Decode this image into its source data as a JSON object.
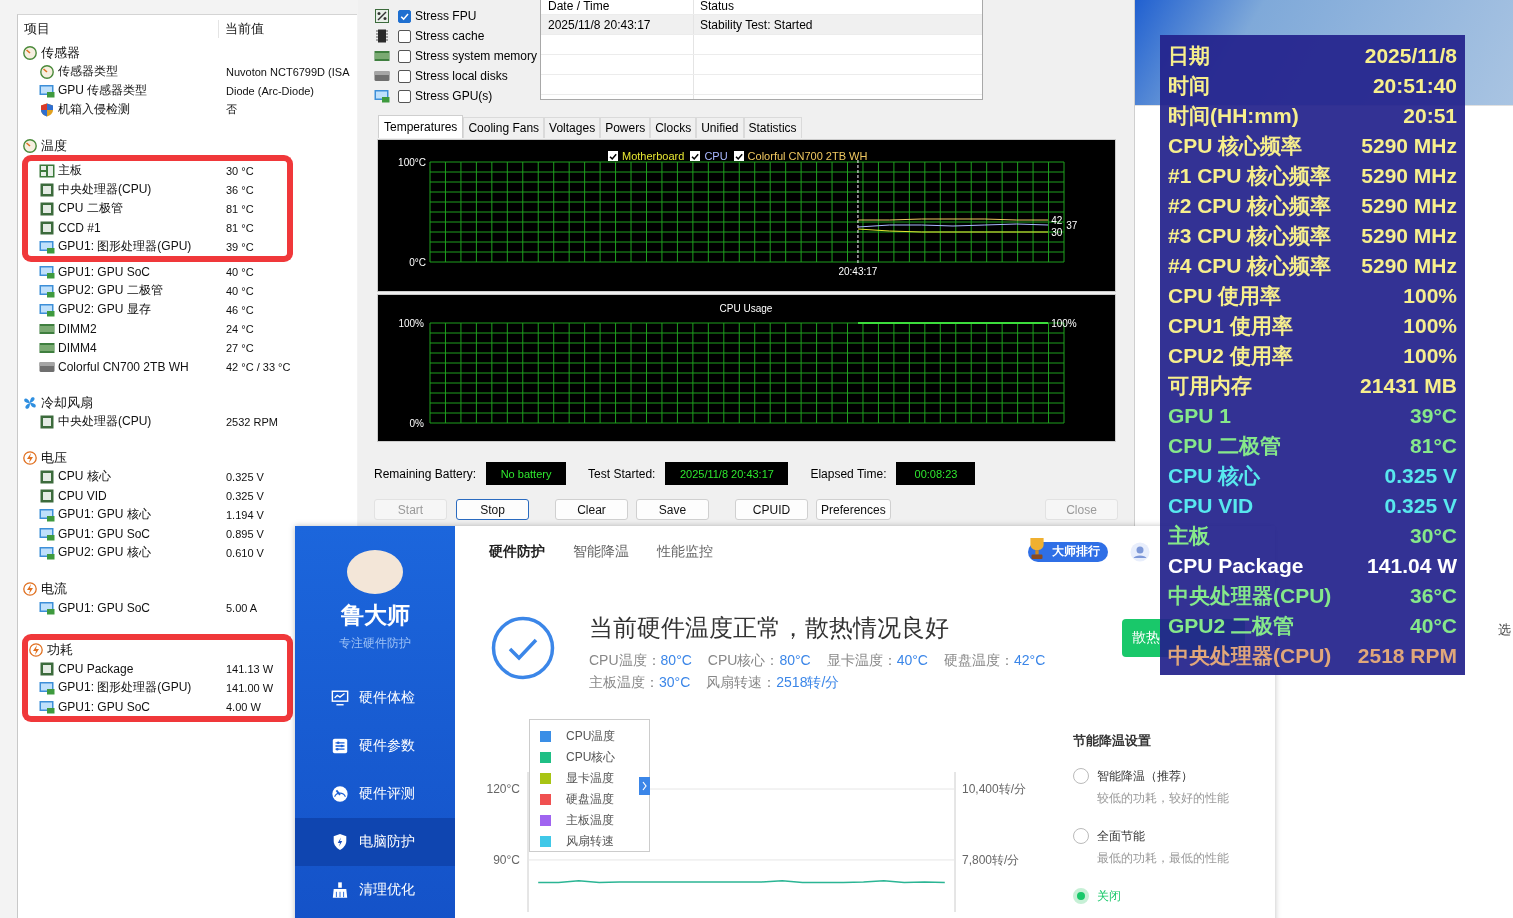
{
  "sensor_window": {
    "columns": [
      "项目",
      "当前值"
    ],
    "groups": [
      {
        "title": "传感器",
        "kind": "gauge",
        "highlight": false,
        "items": [
          {
            "name": "传感器类型",
            "value": "Nuvoton NCT6799D  (ISA",
            "kind": "gauge",
            "highlight": false
          },
          {
            "name": "GPU 传感器类型",
            "value": "Diode  (Arc-Diode)",
            "kind": "gpu",
            "highlight": false
          },
          {
            "name": "机箱入侵检测",
            "value": "否",
            "kind": "shield",
            "highlight": false
          }
        ]
      },
      {
        "title": "温度",
        "kind": "gauge",
        "highlight": false,
        "items": [
          {
            "name": "主板",
            "value": "30 °C",
            "kind": "board",
            "highlight": true
          },
          {
            "name": "中央处理器(CPU)",
            "value": "36 °C",
            "kind": "chip",
            "highlight": true
          },
          {
            "name": "CPU 二极管",
            "value": "81 °C",
            "kind": "chip",
            "highlight": true
          },
          {
            "name": "CCD #1",
            "value": "81 °C",
            "kind": "chip",
            "highlight": true
          },
          {
            "name": "GPU1: 图形处理器(GPU)",
            "value": "39 °C",
            "kind": "gpu",
            "highlight": true
          },
          {
            "name": "GPU1: GPU SoC",
            "value": "40 °C",
            "kind": "gpu",
            "highlight": false
          },
          {
            "name": "GPU2: GPU 二极管",
            "value": "40 °C",
            "kind": "gpu",
            "highlight": false
          },
          {
            "name": "GPU2: GPU 显存",
            "value": "46 °C",
            "kind": "gpu",
            "highlight": false
          },
          {
            "name": "DIMM2",
            "value": "24 °C",
            "kind": "ram",
            "highlight": false
          },
          {
            "name": "DIMM4",
            "value": "27 °C",
            "kind": "ram",
            "highlight": false
          },
          {
            "name": "Colorful CN700 2TB WH",
            "value": "42 °C / 33 °C",
            "kind": "disk",
            "highlight": false
          }
        ]
      },
      {
        "title": "冷却风扇",
        "kind": "fan",
        "highlight": false,
        "items": [
          {
            "name": "中央处理器(CPU)",
            "value": "2532 RPM",
            "kind": "chip",
            "highlight": false
          }
        ]
      },
      {
        "title": "电压",
        "kind": "bolt",
        "highlight": false,
        "items": [
          {
            "name": "CPU 核心",
            "value": "0.325 V",
            "kind": "chip",
            "highlight": false
          },
          {
            "name": "CPU VID",
            "value": "0.325 V",
            "kind": "chip",
            "highlight": false
          },
          {
            "name": "GPU1: GPU 核心",
            "value": "1.194 V",
            "kind": "gpu",
            "highlight": false
          },
          {
            "name": "GPU1: GPU SoC",
            "value": "0.895 V",
            "kind": "gpu",
            "highlight": false
          },
          {
            "name": "GPU2: GPU 核心",
            "value": "0.610 V",
            "kind": "gpu",
            "highlight": false
          }
        ]
      },
      {
        "title": "电流",
        "kind": "bolt",
        "highlight": false,
        "items": [
          {
            "name": "GPU1: GPU SoC",
            "value": "5.00 A",
            "kind": "gpu",
            "highlight": false
          }
        ]
      },
      {
        "title": "功耗",
        "kind": "bolt",
        "highlight": true,
        "items": [
          {
            "name": "CPU Package",
            "value": "141.13 W",
            "kind": "chip",
            "highlight": true
          },
          {
            "name": "GPU1: 图形处理器(GPU)",
            "value": "141.00 W",
            "kind": "gpu",
            "highlight": true
          },
          {
            "name": "GPU1: GPU SoC",
            "value": "4.00 W",
            "kind": "gpu",
            "highlight": true
          }
        ]
      }
    ]
  },
  "stability_window": {
    "stress_options": [
      {
        "label": "Stress FPU",
        "checked": true,
        "kind": "percent"
      },
      {
        "label": "Stress cache",
        "checked": false,
        "kind": "cache"
      },
      {
        "label": "Stress system memory",
        "checked": false,
        "kind": "ram"
      },
      {
        "label": "Stress local disks",
        "checked": false,
        "kind": "disk"
      },
      {
        "label": "Stress GPU(s)",
        "checked": false,
        "kind": "gpu"
      }
    ],
    "log": {
      "columns": [
        "Date / Time",
        "Status"
      ],
      "rows": [
        [
          "2025/11/8 20:43:17",
          "Stability Test: Started"
        ]
      ]
    },
    "tabs": [
      {
        "label": "Temperatures",
        "selected": true
      },
      {
        "label": "Cooling Fans",
        "selected": false
      },
      {
        "label": "Voltages",
        "selected": false
      },
      {
        "label": "Powers",
        "selected": false
      },
      {
        "label": "Clocks",
        "selected": false
      },
      {
        "label": "Unified",
        "selected": false
      },
      {
        "label": "Statistics",
        "selected": false
      }
    ],
    "temperature_chart": {
      "legend": [
        {
          "checked": true
        },
        {
          "checked": true
        },
        {
          "checked": true
        }
      ],
      "start_marker": "20:43:17",
      "chart_data": {
        "type": "line",
        "grid": true,
        "categories": [
          null,
          null,
          null,
          null,
          null,
          null,
          null,
          null,
          null,
          null,
          null,
          null,
          null,
          null,
          null,
          null,
          null,
          null,
          null,
          null
        ],
        "ylim": [
          0,
          100
        ],
        "yticks": [
          {
            "value": 0,
            "label": "0°C"
          },
          {
            "value": 100,
            "label": "100°C"
          }
        ],
        "series": [
          {
            "name": "Motherboard",
            "color": "#e6e632",
            "values": [
              null,
              null,
              null,
              null,
              null,
              null,
              null,
              null,
              null,
              null,
              null,
              null,
              null,
              33,
              31,
              30,
              30,
              30,
              30,
              30
            ]
          },
          {
            "name": "CPU",
            "color": "#aab8ff",
            "values": [
              null,
              null,
              null,
              null,
              null,
              null,
              null,
              null,
              null,
              null,
              null,
              null,
              null,
              35,
              37,
              37,
              36,
              37,
              38,
              37
            ]
          },
          {
            "name": "Colorful CN700 2TB WH",
            "color": "#f0c860",
            "values": [
              null,
              null,
              null,
              null,
              null,
              null,
              null,
              null,
              null,
              null,
              null,
              null,
              null,
              42,
              42,
              43,
              43,
              43,
              42,
              42
            ]
          }
        ],
        "annotations": [
          {
            "text": "30"
          },
          {
            "text": "37"
          },
          {
            "text": "42"
          }
        ]
      }
    },
    "usage_chart": {
      "chart_data": {
        "type": "line",
        "grid": true,
        "title": "CPU Usage",
        "categories": [
          null,
          null,
          null,
          null,
          null,
          null,
          null,
          null,
          null,
          null,
          null,
          null,
          null,
          null,
          null,
          null,
          null,
          null,
          null,
          null
        ],
        "ylim": [
          0,
          100
        ],
        "yticks": [
          {
            "value": 0,
            "label": "0%"
          },
          {
            "value": 100,
            "label": "100%"
          }
        ],
        "series": [
          {
            "color": "#3cdc3c",
            "values": [
              null,
              null,
              null,
              null,
              null,
              null,
              null,
              null,
              null,
              null,
              null,
              null,
              null,
              100,
              100,
              100,
              100,
              100,
              100,
              100
            ]
          }
        ],
        "annotations": [
          {
            "text": "100%"
          }
        ]
      }
    },
    "status_fields": [
      {
        "label": "Remaining Battery:",
        "value": "No battery"
      },
      {
        "label": "Test Started:",
        "value": "2025/11/8 20:43:17"
      },
      {
        "label": "Elapsed Time:",
        "value": "00:08:23"
      }
    ],
    "buttons": [
      {
        "label": "Start",
        "disabled": true,
        "focused": false
      },
      {
        "label": "Stop",
        "disabled": false,
        "focused": true
      },
      {
        "label": "Clear",
        "disabled": false,
        "focused": false
      },
      {
        "label": "Save",
        "disabled": false,
        "focused": false
      },
      {
        "label": "CPUID",
        "disabled": false,
        "focused": false
      },
      {
        "label": "Preferences",
        "disabled": false,
        "focused": false
      },
      {
        "label": "Close",
        "disabled": true,
        "focused": false
      }
    ]
  },
  "ludashi": {
    "brand": "鲁大师",
    "tagline": "专注硬件防护",
    "nav": [
      {
        "label": "硬件体检",
        "kind": "monitor",
        "selected": false
      },
      {
        "label": "硬件参数",
        "kind": "sliders",
        "selected": false
      },
      {
        "label": "硬件评测",
        "kind": "speedometer",
        "selected": false
      },
      {
        "label": "电脑防护",
        "kind": "shield",
        "selected": true
      },
      {
        "label": "清理优化",
        "kind": "broom",
        "selected": false
      }
    ],
    "tabs": [
      {
        "label": "硬件防护",
        "selected": true
      },
      {
        "label": "智能降温",
        "selected": false
      },
      {
        "label": "性能监控",
        "selected": false
      }
    ],
    "rank_badge": "大师排行",
    "status_title": "当前硬件温度正常，散热情况良好",
    "reading_lines": [
      [
        {
          "label": "CPU温度：",
          "value": "80°C"
        },
        {
          "label": "CPU核心：",
          "value": "80°C"
        },
        {
          "label": "显卡温度：",
          "value": "40°C"
        },
        {
          "label": "硬盘温度：",
          "value": "42°C"
        }
      ],
      [
        {
          "label": "主板温度：",
          "value": "30°C"
        },
        {
          "label": "风扇转速：",
          "value": "2518转/分"
        }
      ]
    ],
    "action_button": "散热",
    "legend": [
      {
        "label": "CPU温度",
        "color": "#3a8ee6"
      },
      {
        "label": "CPU核心",
        "color": "#1fbf85"
      },
      {
        "label": "显卡温度",
        "color": "#a8c414"
      },
      {
        "label": "硬盘温度",
        "color": "#f05050"
      },
      {
        "label": "主板温度",
        "color": "#a064f0"
      },
      {
        "label": "风扇转速",
        "color": "#40c8e8"
      }
    ],
    "chart_data": {
      "type": "line",
      "categories": [
        null,
        null,
        null,
        null,
        null,
        null,
        null,
        null,
        null,
        null,
        null,
        null,
        null,
        null,
        null,
        null,
        null,
        null,
        null,
        null,
        null
      ],
      "ylim": [
        68,
        120
      ],
      "yticks": [
        {
          "value": 120,
          "label": "120°C"
        },
        {
          "value": 90,
          "label": "90°C"
        }
      ],
      "series": [
        {
          "color": "#2bb594",
          "values": [
            80.5,
            80.5,
            81.2,
            80.5,
            80.7,
            80.7,
            80.7,
            80.7,
            80.7,
            80.7,
            80.7,
            80.7,
            81.2,
            80.5,
            80.5,
            80.5,
            80.7,
            81.2,
            80.5,
            80.7,
            80.5
          ]
        }
      ]
    },
    "right_axis_labels": [
      "10,400转/分",
      "7,800转/分"
    ],
    "settings": {
      "title": "节能降温设置",
      "options": [
        {
          "label": "智能降温（推荐）",
          "description": "较低的功耗，较好的性能",
          "selected": false
        },
        {
          "label": "全面节能",
          "description": "最低的功耗，最低的性能",
          "selected": false
        },
        {
          "label": "关闭",
          "selected": true
        }
      ]
    }
  },
  "osd_panel": {
    "rows": [
      {
        "label": "日期",
        "value": "2025/11/8",
        "color": "#f7ef8c"
      },
      {
        "label": "时间",
        "value": "20:51:40",
        "color": "#f7ef8c"
      },
      {
        "label": "时间(HH:mm)",
        "value": "20:51",
        "color": "#f7ef8c"
      },
      {
        "label": "CPU 核心频率",
        "value": "5290 MHz",
        "color": "#f7ef8c"
      },
      {
        "label": "#1 CPU 核心频率",
        "value": "5290 MHz",
        "color": "#f7ef8c"
      },
      {
        "label": "#2 CPU 核心频率",
        "value": "5290 MHz",
        "color": "#f7ef8c"
      },
      {
        "label": "#3 CPU 核心频率",
        "value": "5290 MHz",
        "color": "#f7ef8c"
      },
      {
        "label": "#4 CPU 核心频率",
        "value": "5290 MHz",
        "color": "#f7ef8c"
      },
      {
        "label": "CPU 使用率",
        "value": "100%",
        "color": "#f7ef8c"
      },
      {
        "label": "CPU1 使用率",
        "value": "100%",
        "color": "#f7ef8c"
      },
      {
        "label": "CPU2 使用率",
        "value": "100%",
        "color": "#f7ef8c"
      },
      {
        "label": "可用内存",
        "value": "21431 MB",
        "color": "#f7ef8c"
      },
      {
        "label": "GPU 1",
        "value": "39°C",
        "color": "#86e88a"
      },
      {
        "label": "CPU 二极管",
        "value": "81°C",
        "color": "#86e88a"
      },
      {
        "label": "CPU 核心",
        "value": "0.325 V",
        "color": "#58e8ee"
      },
      {
        "label": "CPU VID",
        "value": "0.325 V",
        "color": "#58e8ee"
      },
      {
        "label": "主板",
        "value": "30°C",
        "color": "#86e88a"
      },
      {
        "label": "CPU Package",
        "value": "141.04 W",
        "color": "#ffffff"
      },
      {
        "label": "中央处理器(CPU)",
        "value": "36°C",
        "color": "#86e88a"
      },
      {
        "label": "GPU2 二极管",
        "value": "40°C",
        "color": "#86e88a"
      },
      {
        "label": "中央处理器(CPU)",
        "value": "2518 RPM",
        "color": "#e0a77a"
      }
    ]
  },
  "desktop": {
    "explorer_fragment": "选"
  }
}
